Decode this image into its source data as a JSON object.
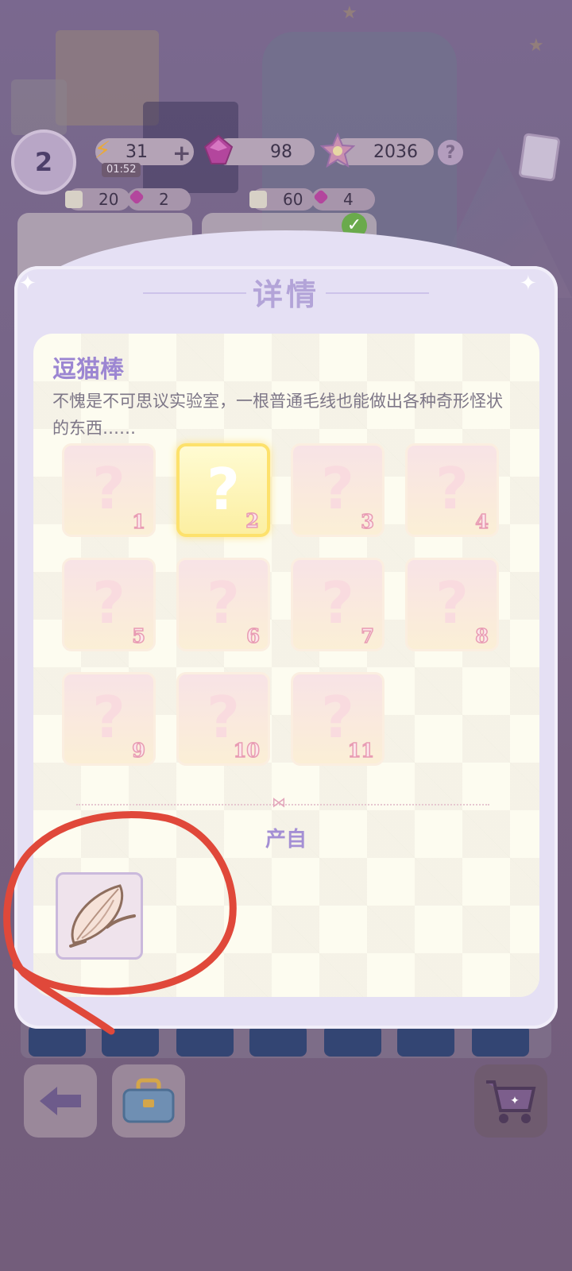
{
  "hud": {
    "level": "2",
    "energy": "31",
    "plus": "+",
    "energy_timer": "01:52",
    "gems": "98",
    "stars": "2036",
    "help": "?"
  },
  "order_cards": [
    {
      "coins": "20",
      "gems": "2"
    },
    {
      "coins": "60",
      "gems": "4"
    }
  ],
  "modal": {
    "title": "详情",
    "item_name": "逗猫棒",
    "description": "不愧是不可思议实验室，一根普通毛线也能做出各种奇形怪状的东西……",
    "slots": [
      {
        "glyph": "?",
        "number": "1"
      },
      {
        "glyph": "?",
        "number": "2"
      },
      {
        "glyph": "?",
        "number": "3"
      },
      {
        "glyph": "?",
        "number": "4"
      },
      {
        "glyph": "?",
        "number": "5"
      },
      {
        "glyph": "?",
        "number": "6"
      },
      {
        "glyph": "?",
        "number": "7"
      },
      {
        "glyph": "?",
        "number": "8"
      },
      {
        "glyph": "?",
        "number": "9"
      },
      {
        "glyph": "?",
        "number": "10"
      },
      {
        "glyph": "?",
        "number": "11"
      }
    ],
    "selected_slot": 2,
    "source_label": "产自",
    "source_item_icon": "yarn-shell-icon"
  },
  "annotation": {
    "color": "#e0483a",
    "shape": "hand-drawn-circle"
  },
  "colors": {
    "accent_purple": "#9c86d2",
    "slot_selected": "#fde16c",
    "slot_number_stroke": "#e89cb3"
  }
}
